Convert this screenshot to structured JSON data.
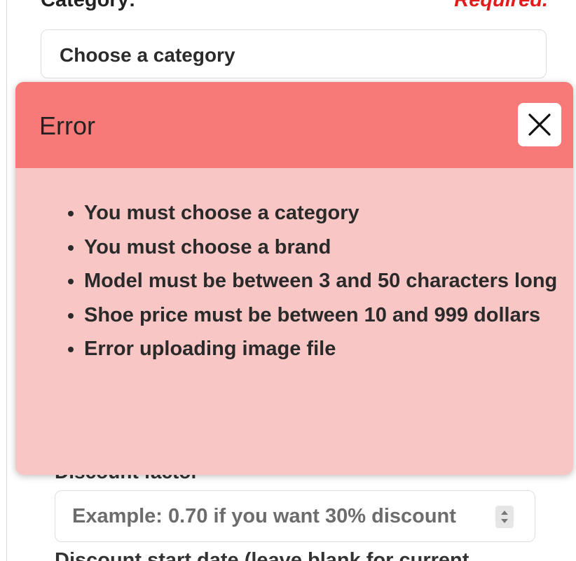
{
  "form": {
    "category_label": "Category:",
    "required_label": "Required.",
    "category_select_value": "Choose a category",
    "discount_label_peek": "Discount factor",
    "discount_placeholder": "Example: 0.70 if you want 30% discount",
    "next_label": "Discount start date (leave blank for current"
  },
  "error_modal": {
    "title": "Error",
    "close_icon": "close-icon",
    "messages": [
      "You must choose a category",
      "You must choose a brand",
      "Model must be between 3 and 50 characters long",
      "Shoe price must be between 10 and 999 dollars",
      "Error uploading image file"
    ]
  },
  "colors": {
    "header_bg": "#f77a79",
    "body_bg": "#f8c6c5",
    "required": "#e21b1b"
  }
}
